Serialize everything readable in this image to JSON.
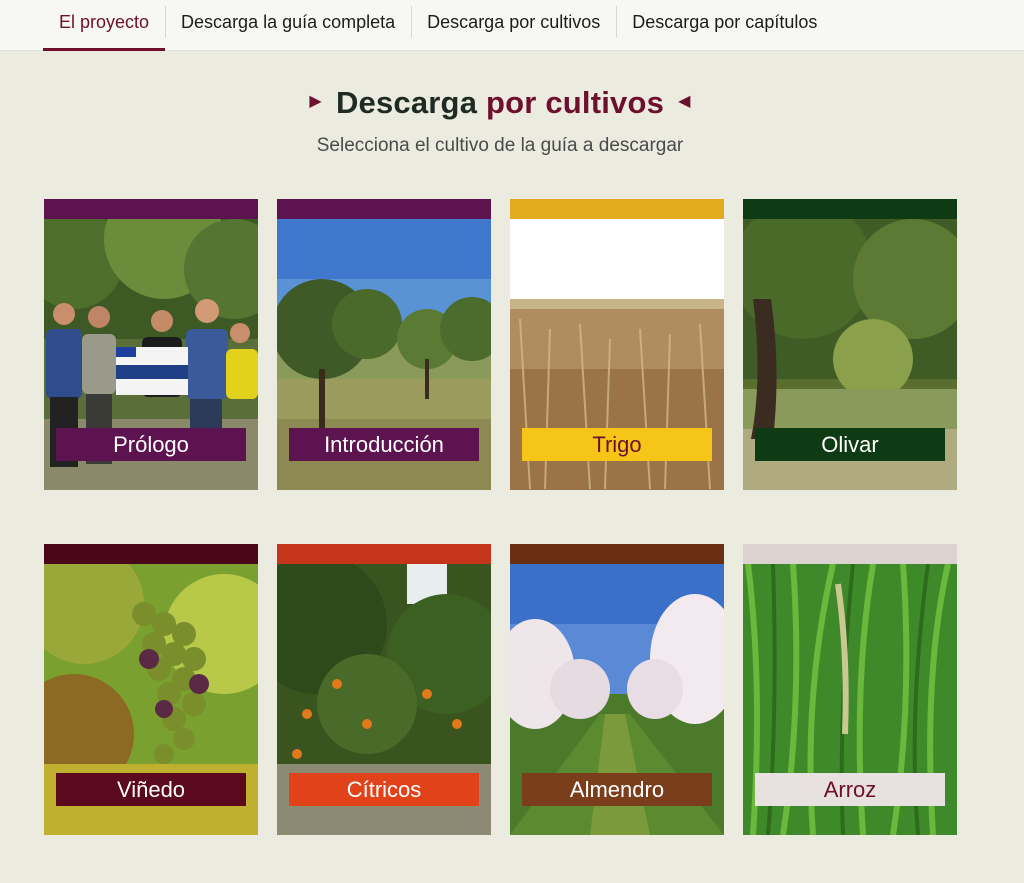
{
  "nav": {
    "tabs": [
      {
        "label": "El proyecto",
        "active": true
      },
      {
        "label": "Descarga la guía completa",
        "active": false
      },
      {
        "label": "Descarga por cultivos",
        "active": false
      },
      {
        "label": "Descarga por capítulos",
        "active": false
      }
    ]
  },
  "heading": {
    "part1": "Descarga",
    "part2": "por cultivos",
    "subtitle": "Selecciona el cultivo de la guía a descargar"
  },
  "colors": {
    "accent": "#6d0f2d",
    "background": "#ebebe0"
  },
  "cards": [
    {
      "label": "Prólogo",
      "bar_color": "#5c1350",
      "label_bg": "#5c1350",
      "label_color": "#ffffff",
      "photo": "group-photo"
    },
    {
      "label": "Introducción",
      "bar_color": "#5c1350",
      "label_bg": "#5c1350",
      "label_color": "#ffffff",
      "photo": "trees-photo"
    },
    {
      "label": "Trigo",
      "bar_color": "#e2aa1f",
      "label_bg": "#f5c518",
      "label_color": "#6d0f2d",
      "photo": "wheat-photo"
    },
    {
      "label": "Olivar",
      "bar_color": "#0e3a14",
      "label_bg": "#0e3a14",
      "label_color": "#ffffff",
      "photo": "olive-photo"
    },
    {
      "label": "Viñedo",
      "bar_color": "#4a0717",
      "label_bg": "#5a0a1c",
      "label_color": "#ffffff",
      "photo": "grapes-photo"
    },
    {
      "label": "Cítricos",
      "bar_color": "#c4351a",
      "label_bg": "#e2421a",
      "label_color": "#ffffff",
      "photo": "citrus-photo"
    },
    {
      "label": "Almendro",
      "bar_color": "#6a2f12",
      "label_bg": "#7a3e1c",
      "label_color": "#ffffff",
      "photo": "almond-photo"
    },
    {
      "label": "Arroz",
      "bar_color": "#dcd3d0",
      "label_bg": "#e7e2e0",
      "label_color": "#6d0f2d",
      "photo": "rice-photo"
    }
  ]
}
